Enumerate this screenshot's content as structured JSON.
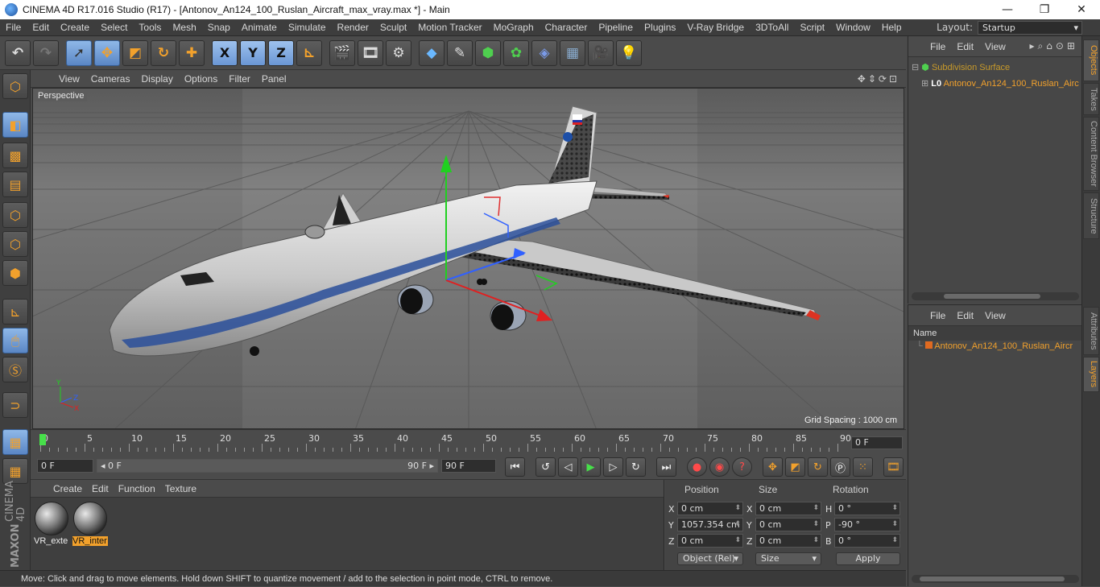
{
  "window": {
    "title": "CINEMA 4D R17.016 Studio (R17) - [Antonov_An124_100_Ruslan_Aircraft_max_vray.max *] - Main",
    "minimize": "—",
    "maximize": "❐",
    "close": "✕"
  },
  "menubar": {
    "items": [
      "File",
      "Edit",
      "Create",
      "Select",
      "Tools",
      "Mesh",
      "Snap",
      "Animate",
      "Simulate",
      "Render",
      "Sculpt",
      "Motion Tracker",
      "MoGraph",
      "Character",
      "Pipeline",
      "Plugins",
      "V-Ray Bridge",
      "3DToAll",
      "Script",
      "Window",
      "Help"
    ],
    "layout_label": "Layout:",
    "layout_value": "Startup"
  },
  "toolbar": {
    "axis_x": "X",
    "axis_y": "Y",
    "axis_z": "Z"
  },
  "viewport": {
    "menu": [
      "View",
      "Cameras",
      "Display",
      "Options",
      "Filter",
      "Panel"
    ],
    "label": "Perspective",
    "grid_spacing": "Grid Spacing : 1000 cm"
  },
  "timeline": {
    "ticks": [
      "0",
      "5",
      "10",
      "15",
      "20",
      "25",
      "30",
      "35",
      "40",
      "45",
      "50",
      "55",
      "60",
      "65",
      "70",
      "75",
      "80",
      "85",
      "90"
    ],
    "current_frame": "0 F"
  },
  "transport": {
    "start": "0 F",
    "range_start": "◂ 0 F",
    "range_end": "90 F ▸",
    "end": "90 F"
  },
  "materials": {
    "menu": [
      "Create",
      "Edit",
      "Function",
      "Texture"
    ],
    "items": [
      {
        "label": "VR_exte",
        "selected": false
      },
      {
        "label": "VR_inter",
        "selected": true
      }
    ]
  },
  "coords": {
    "headers": {
      "position": "Position",
      "size": "Size",
      "rotation": "Rotation"
    },
    "rows": [
      {
        "axis": "X",
        "pos": "0 cm",
        "size_axis": "X",
        "size": "0 cm",
        "rot_axis": "H",
        "rot": "0 °"
      },
      {
        "axis": "Y",
        "pos": "1057.354 cm",
        "size_axis": "Y",
        "size": "0 cm",
        "rot_axis": "P",
        "rot": "-90 °"
      },
      {
        "axis": "Z",
        "pos": "0 cm",
        "size_axis": "Z",
        "size": "0 cm",
        "rot_axis": "B",
        "rot": "0 °"
      }
    ],
    "mode": "Object (Rel)",
    "size_mode": "Size",
    "apply": "Apply"
  },
  "objects": {
    "menu": [
      "File",
      "Edit",
      "View"
    ],
    "items": [
      {
        "name": "Subdivision Surface",
        "color": "#c89a2a"
      },
      {
        "name": "Antonov_An124_100_Ruslan_Airc",
        "color": "#f2a12c"
      }
    ]
  },
  "layers": {
    "menu": [
      "File",
      "Edit",
      "View"
    ],
    "header": "Name",
    "items": [
      {
        "name": "Antonov_An124_100_Ruslan_Aircr",
        "color": "#f2a12c"
      }
    ]
  },
  "sidetabs": [
    "Objects",
    "Takes",
    "Content Browser",
    "Structure",
    "Attributes",
    "Layers"
  ],
  "status": "Move: Click and drag to move elements. Hold down SHIFT to quantize movement / add to the selection in point mode, CTRL to remove.",
  "brand": {
    "maxon": "MAXON",
    "c4d": "CINEMA 4D"
  },
  "colors": {
    "accent": "#f2a12c",
    "selection": "#5a86c4"
  }
}
